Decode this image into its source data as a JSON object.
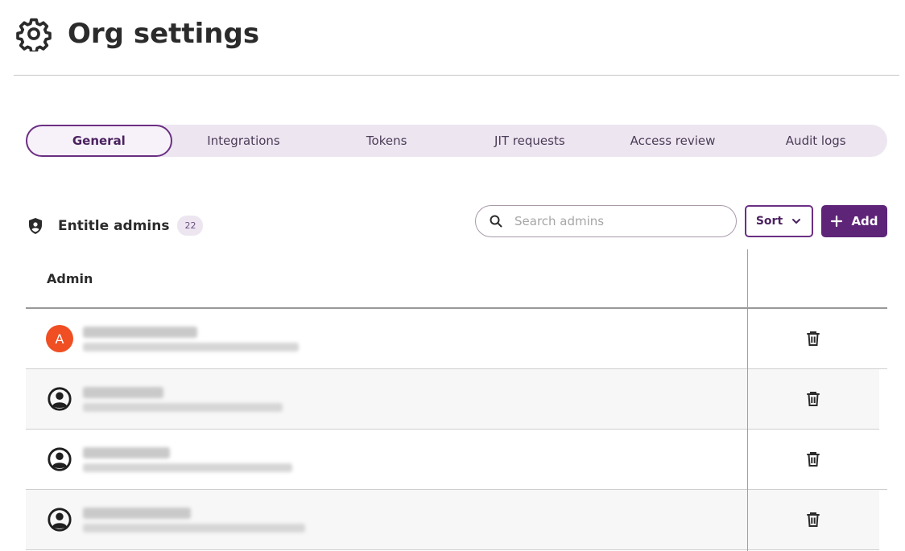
{
  "page": {
    "title": "Org settings"
  },
  "tabs": [
    {
      "label": "General",
      "active": true
    },
    {
      "label": "Integrations",
      "active": false
    },
    {
      "label": "Tokens",
      "active": false
    },
    {
      "label": "JIT requests",
      "active": false
    },
    {
      "label": "Access review",
      "active": false
    },
    {
      "label": "Audit logs",
      "active": false
    }
  ],
  "section": {
    "title": "Entitle admins",
    "count": "22"
  },
  "search": {
    "placeholder": "Search admins",
    "value": ""
  },
  "toolbar": {
    "sort_label": "Sort",
    "add_label": "Add"
  },
  "table": {
    "columns": [
      "Admin"
    ],
    "rows": [
      {
        "avatar": "A",
        "avatar_type": "letter",
        "name": "",
        "email": ""
      },
      {
        "avatar": "",
        "avatar_type": "user-icon",
        "name": "",
        "email": ""
      },
      {
        "avatar": "",
        "avatar_type": "user-icon",
        "name": "",
        "email": ""
      },
      {
        "avatar": "",
        "avatar_type": "user-icon",
        "name": "",
        "email": ""
      }
    ]
  },
  "colors": {
    "accent": "#5e2478",
    "tab_bg": "#ede6f1",
    "avatar_orange": "#f04e23"
  },
  "icons": [
    "gear-icon",
    "shield-icon",
    "search-icon",
    "chevron-down-icon",
    "plus-icon",
    "user-circle-icon",
    "trash-icon"
  ]
}
